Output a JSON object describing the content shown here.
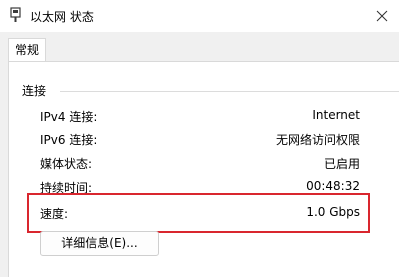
{
  "window": {
    "title": "以太网 状态",
    "icon": "network-adapter-icon",
    "close_icon": "close-icon"
  },
  "tabs": [
    {
      "label": "常规",
      "selected": true
    }
  ],
  "connection": {
    "group_label": "连接",
    "rows": [
      {
        "label": "IPv4 连接:",
        "value": "Internet"
      },
      {
        "label": "IPv6 连接:",
        "value": "无网络访问权限"
      },
      {
        "label": "媒体状态:",
        "value": "已启用"
      },
      {
        "label": "持续时间:",
        "value": "00:48:32"
      },
      {
        "label": "速度:",
        "value": "1.0 Gbps"
      }
    ]
  },
  "buttons": {
    "details_label": "详细信息(E)..."
  },
  "colors": {
    "highlight": "#d9262e",
    "panel_bg": "#ffffff",
    "window_bg": "#f0f0f0"
  }
}
